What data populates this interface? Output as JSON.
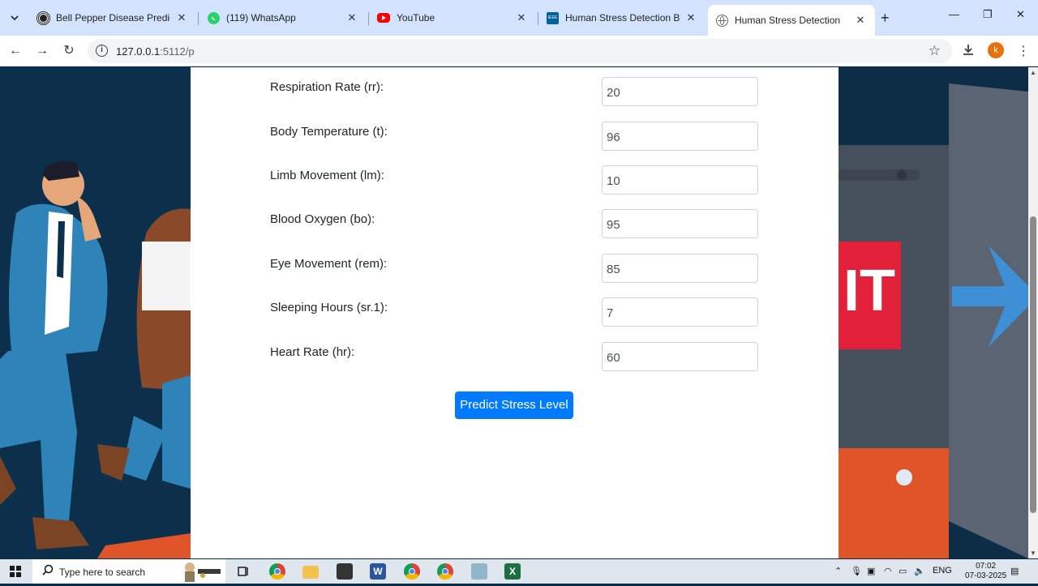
{
  "browser": {
    "tabs": [
      {
        "title": "Bell Pepper Disease Prediction",
        "icon": "target-icon"
      },
      {
        "title": "(119) WhatsApp",
        "icon": "whatsapp-icon"
      },
      {
        "title": "YouTube",
        "icon": "youtube-icon"
      },
      {
        "title": "Human Stress Detection Based",
        "icon": "ieee-icon"
      },
      {
        "title": "Human Stress Detection",
        "icon": "globe-icon"
      }
    ],
    "active_tab": 4,
    "url_host": "127.0.0.1",
    "url_path": ":5112/p",
    "profile_initial": "k"
  },
  "form": {
    "fields": [
      {
        "label": "Respiration Rate (rr):",
        "value": "20"
      },
      {
        "label": "Body Temperature (t):",
        "value": "96"
      },
      {
        "label": "Limb Movement (lm):",
        "value": "10"
      },
      {
        "label": "Blood Oxygen (bo):",
        "value": "95"
      },
      {
        "label": "Eye Movement (rem):",
        "value": "85"
      },
      {
        "label": "Sleeping Hours (sr.1):",
        "value": "7"
      },
      {
        "label": "Heart Rate (hr):",
        "value": "60"
      }
    ],
    "submit_label": "Predict Stress Level"
  },
  "background": {
    "exit_sign_text": "IT"
  },
  "taskbar": {
    "search_placeholder": "Type here to search",
    "language": "ENG",
    "time": "07:02",
    "date": "07-03-2025"
  },
  "colors": {
    "primary_button": "#007bff",
    "page_background": "#0c2f4c",
    "tab_strip": "#d3e3fd"
  }
}
